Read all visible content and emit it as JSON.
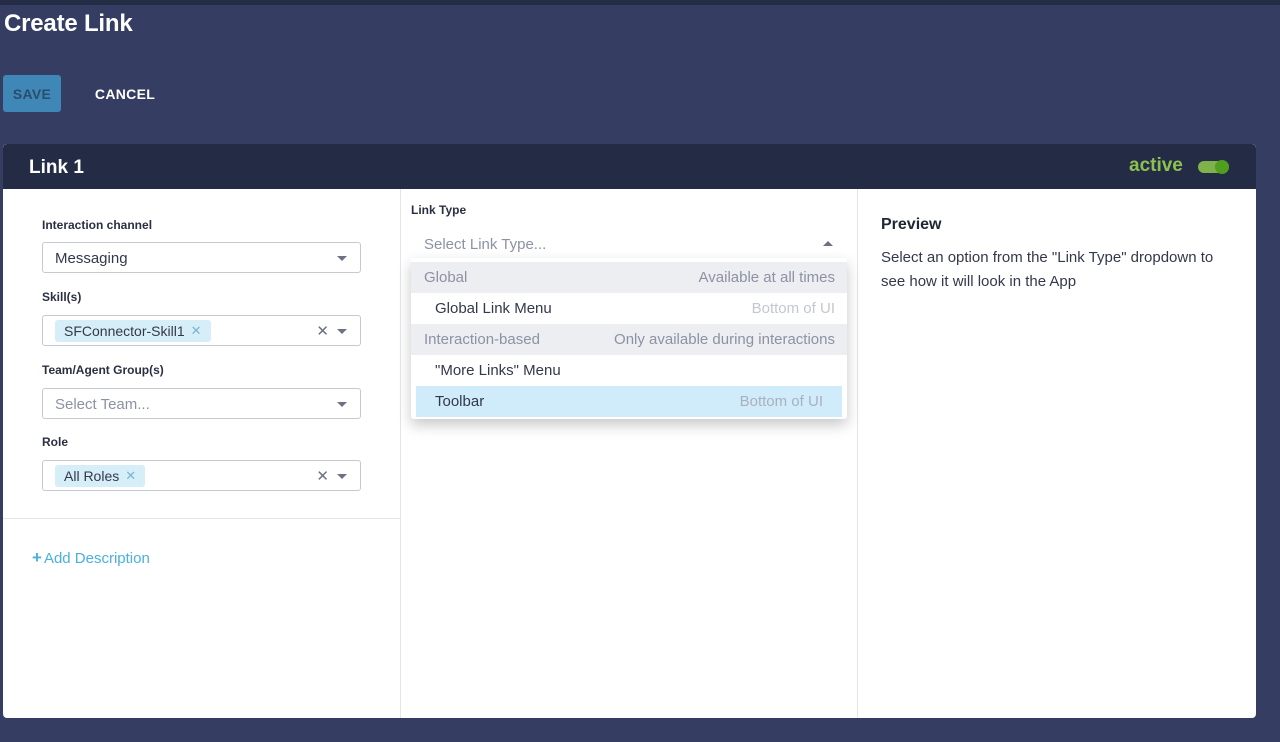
{
  "page": {
    "title": "Create Link"
  },
  "actions": {
    "save_label": "SAVE",
    "cancel_label": "CANCEL"
  },
  "card": {
    "title": "Link 1",
    "status_label": "active",
    "active": true,
    "accent_color": "#8cc152"
  },
  "form": {
    "interaction_channel": {
      "label": "Interaction channel",
      "value": "Messaging"
    },
    "skills": {
      "label": "Skill(s)",
      "chips": [
        "SFConnector-Skill1"
      ]
    },
    "team": {
      "label": "Team/Agent Group(s)",
      "placeholder": "Select Team..."
    },
    "role": {
      "label": "Role",
      "chips": [
        "All Roles"
      ]
    },
    "add_description": "Add Description"
  },
  "link_type": {
    "label": "Link Type",
    "placeholder": "Select Link Type...",
    "open": true,
    "options": [
      {
        "kind": "group",
        "label": "Global",
        "hint": "Available at all times"
      },
      {
        "kind": "item",
        "label": "Global Link Menu",
        "hint": "Bottom of UI"
      },
      {
        "kind": "group",
        "label": "Interaction-based",
        "hint": "Only available during interactions"
      },
      {
        "kind": "item",
        "label": "\"More Links\" Menu",
        "hint": ""
      },
      {
        "kind": "item",
        "label": "Toolbar",
        "hint": "Bottom of UI",
        "highlighted": true
      }
    ]
  },
  "preview": {
    "title": "Preview",
    "text": "Select an option from the \"Link Type\" dropdown to see how it will look in the App"
  },
  "colors": {
    "background": "#353e62",
    "header": "#232b45",
    "save_button": "#3e87b7",
    "chip": "#d6eef8",
    "highlight": "#d0ecfa",
    "link": "#4ab0e0"
  }
}
